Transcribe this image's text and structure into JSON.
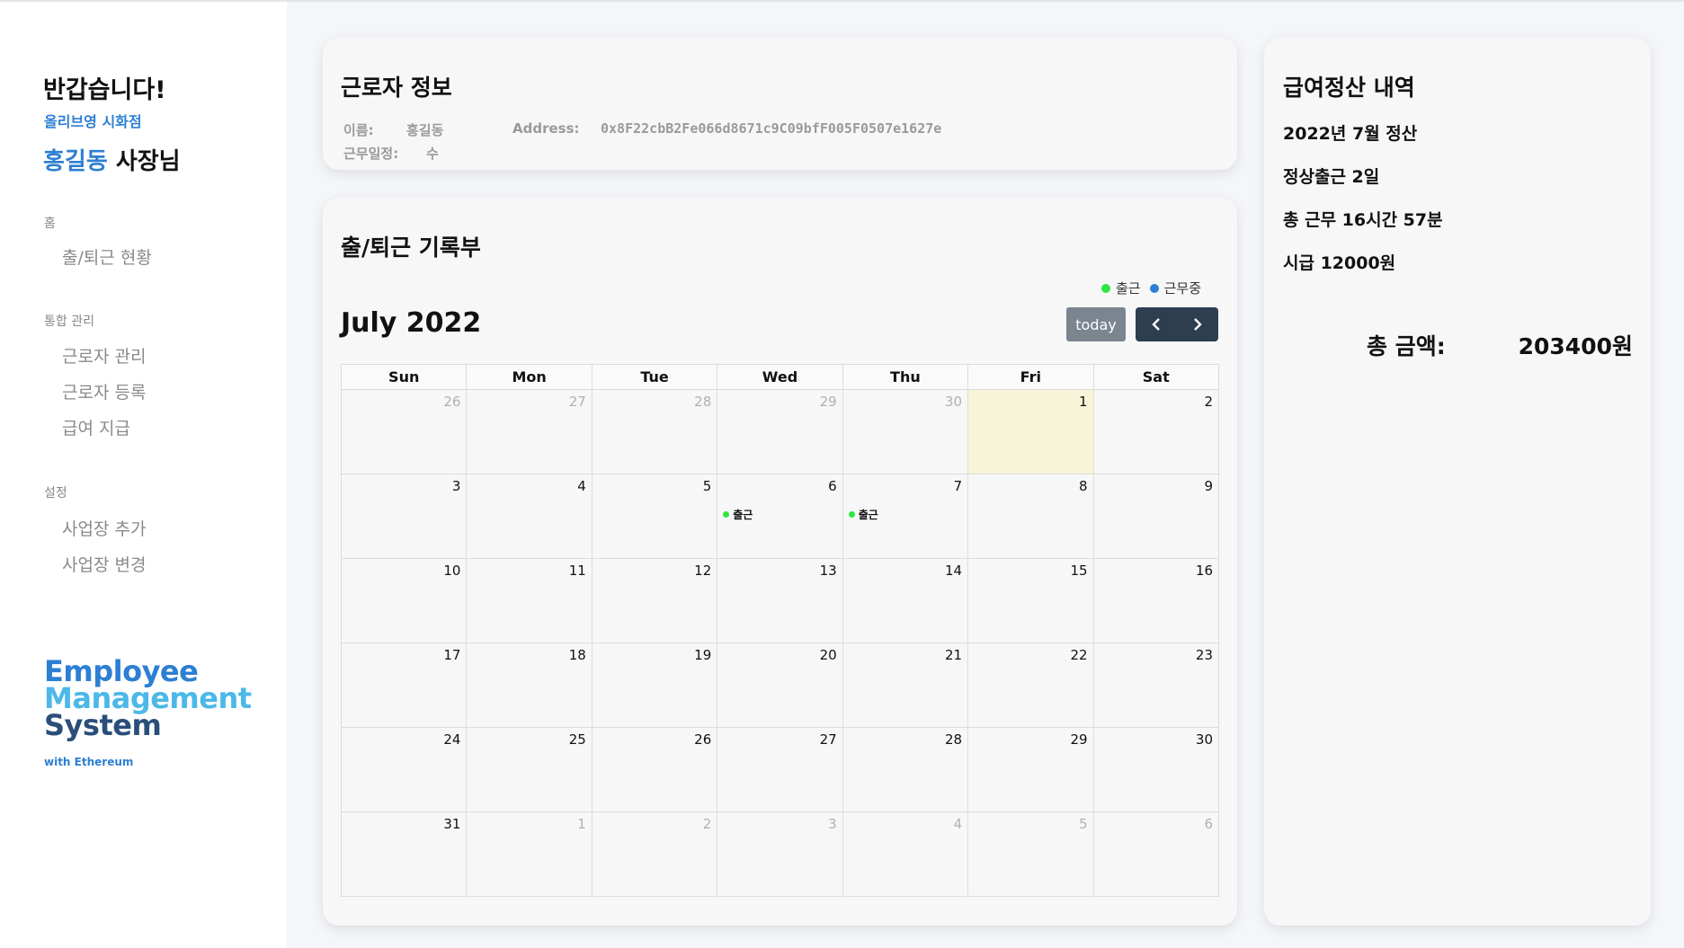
{
  "sidebar": {
    "greeting": "반갑습니다!",
    "store_name": "올리브영 시화점",
    "owner_name": "홍길동",
    "owner_suffix": " 사장님",
    "sections": [
      {
        "label": "홈",
        "items": [
          "출/퇴근 현황"
        ]
      },
      {
        "label": "통합 관리",
        "items": [
          "근로자 관리",
          "근로자 등록",
          "급여 지급"
        ]
      },
      {
        "label": "설정",
        "items": [
          "사업장 추가",
          "사업장 변경"
        ]
      }
    ],
    "logo": {
      "line1": "Employee",
      "line2": "Management",
      "line3": "System",
      "sub": "with Ethereum"
    }
  },
  "worker_info": {
    "title": "근로자 정보",
    "name_label": "이름:",
    "name_value": "홍길동",
    "address_label": "Address:",
    "address_value": "0x8F22cbB2Fe066d8671c9C09bfF005F0507e1627e",
    "schedule_label": "근무일정:",
    "schedule_value": "수"
  },
  "attendance": {
    "title": "출/퇴근 기록부",
    "legend": [
      {
        "label": "출근",
        "color": "#2ee640"
      },
      {
        "label": "근무중",
        "color": "#2d7fd3"
      }
    ],
    "month_title": "July 2022",
    "today_label": "today",
    "prev_icon": "‹",
    "next_icon": "›",
    "weekdays": [
      "Sun",
      "Mon",
      "Tue",
      "Wed",
      "Thu",
      "Fri",
      "Sat"
    ],
    "weeks": [
      [
        {
          "d": "26",
          "o": true
        },
        {
          "d": "27",
          "o": true
        },
        {
          "d": "28",
          "o": true
        },
        {
          "d": "29",
          "o": true
        },
        {
          "d": "30",
          "o": true
        },
        {
          "d": "1",
          "t": true
        },
        {
          "d": "2"
        }
      ],
      [
        {
          "d": "3"
        },
        {
          "d": "4"
        },
        {
          "d": "5"
        },
        {
          "d": "6",
          "e": "출근"
        },
        {
          "d": "7",
          "e": "출근"
        },
        {
          "d": "8"
        },
        {
          "d": "9"
        }
      ],
      [
        {
          "d": "10"
        },
        {
          "d": "11"
        },
        {
          "d": "12"
        },
        {
          "d": "13"
        },
        {
          "d": "14"
        },
        {
          "d": "15"
        },
        {
          "d": "16"
        }
      ],
      [
        {
          "d": "17"
        },
        {
          "d": "18"
        },
        {
          "d": "19"
        },
        {
          "d": "20"
        },
        {
          "d": "21"
        },
        {
          "d": "22"
        },
        {
          "d": "23"
        }
      ],
      [
        {
          "d": "24"
        },
        {
          "d": "25"
        },
        {
          "d": "26"
        },
        {
          "d": "27"
        },
        {
          "d": "28"
        },
        {
          "d": "29"
        },
        {
          "d": "30"
        }
      ],
      [
        {
          "d": "31"
        },
        {
          "d": "1",
          "o": true
        },
        {
          "d": "2",
          "o": true
        },
        {
          "d": "3",
          "o": true
        },
        {
          "d": "4",
          "o": true
        },
        {
          "d": "5",
          "o": true
        },
        {
          "d": "6",
          "o": true
        }
      ]
    ]
  },
  "payroll": {
    "title": "급여정산 내역",
    "period": "2022년 7월 정산",
    "attendance_count": "정상출근 2일",
    "total_hours": "총 근무 16시간 57분",
    "hourly_wage": "시급 12000원",
    "total_label": "총 금액:",
    "total_value": "203400원"
  }
}
